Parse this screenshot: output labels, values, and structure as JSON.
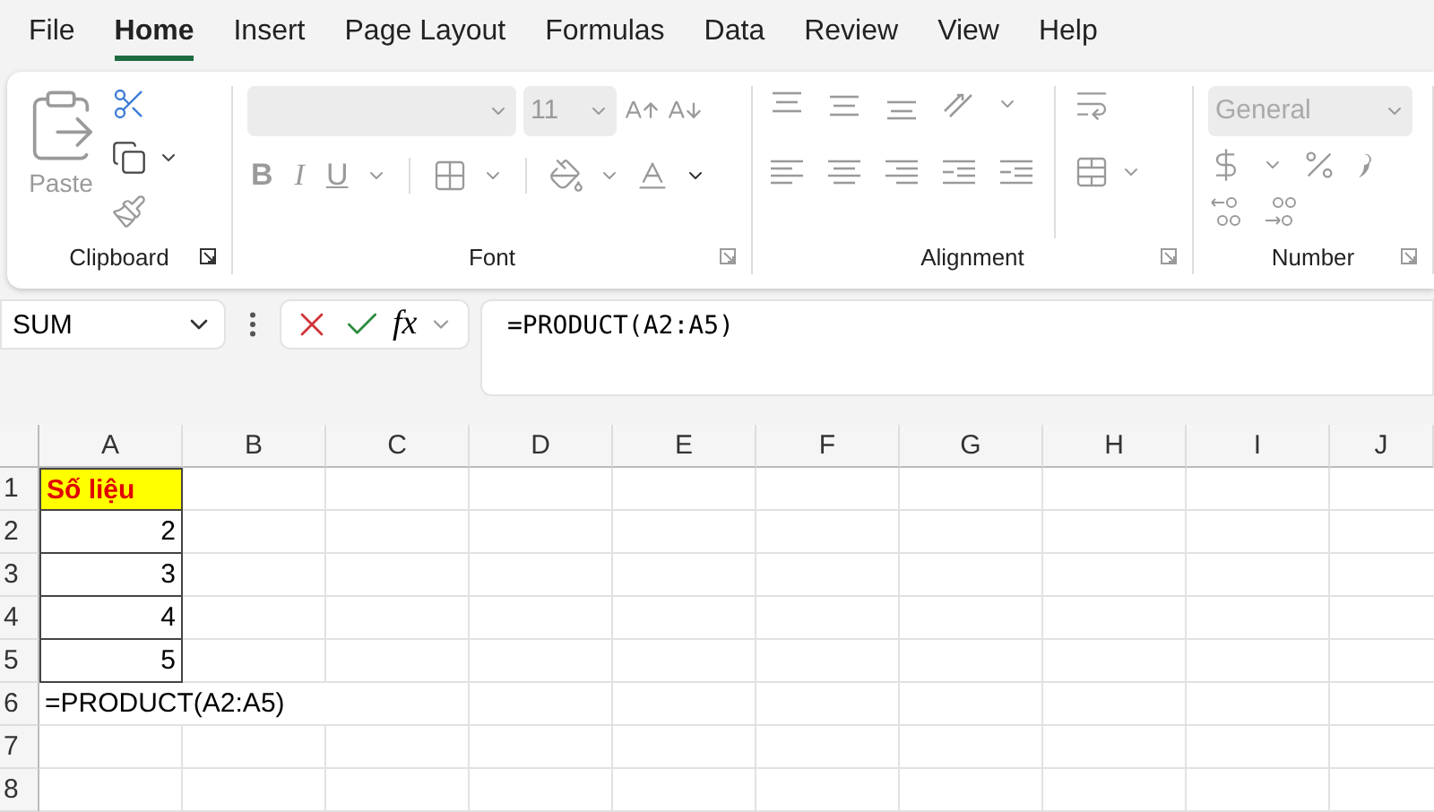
{
  "tabs": [
    {
      "label": "File",
      "selected": false
    },
    {
      "label": "Home",
      "selected": true
    },
    {
      "label": "Insert",
      "selected": false
    },
    {
      "label": "Page Layout",
      "selected": false
    },
    {
      "label": "Formulas",
      "selected": false
    },
    {
      "label": "Data",
      "selected": false
    },
    {
      "label": "Review",
      "selected": false
    },
    {
      "label": "View",
      "selected": false
    },
    {
      "label": "Help",
      "selected": false
    }
  ],
  "ribbon": {
    "disabled": true,
    "clipboard": {
      "title": "Clipboard",
      "paste": "Paste"
    },
    "font": {
      "title": "Font",
      "size": "11",
      "styles": [
        "B",
        "I",
        "U"
      ]
    },
    "alignment": {
      "title": "Alignment"
    },
    "number": {
      "title": "Number",
      "format": "General"
    }
  },
  "formula_bar": {
    "name_box": "SUM",
    "fx": "fx",
    "formula": "=PRODUCT(A2:A5)"
  },
  "sheet": {
    "columns": [
      "A",
      "B",
      "C",
      "D",
      "E",
      "F",
      "G",
      "H",
      "I",
      "J"
    ],
    "rows": [
      {
        "number": "1",
        "cell": {
          "kind": "label",
          "text": "Số liệu"
        }
      },
      {
        "number": "2",
        "cell": {
          "kind": "number",
          "text": "2"
        }
      },
      {
        "number": "3",
        "cell": {
          "kind": "number",
          "text": "3"
        }
      },
      {
        "number": "4",
        "cell": {
          "kind": "number",
          "text": "4"
        }
      },
      {
        "number": "5",
        "cell": {
          "kind": "number",
          "text": "5"
        }
      },
      {
        "number": "6",
        "cell": {
          "kind": "formula",
          "text": "=PRODUCT(A2:A5)"
        }
      },
      {
        "number": "7"
      },
      {
        "number": "8"
      }
    ]
  }
}
